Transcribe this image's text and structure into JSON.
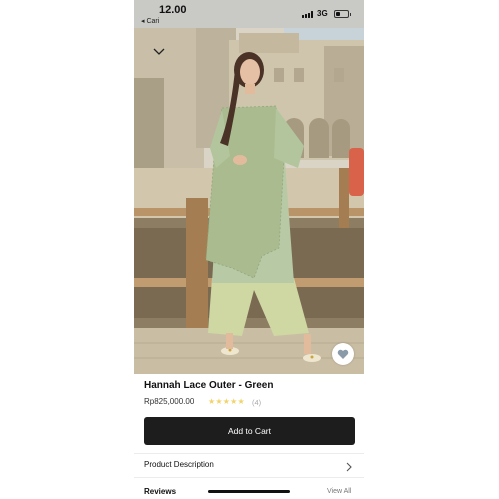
{
  "status_bar": {
    "time": "12.00",
    "back_label": "◂ Cari",
    "network": "3G"
  },
  "icons": {
    "collapse": "chevron-down-icon",
    "wishlist": "heart-icon",
    "description": "chevron-right-icon"
  },
  "product": {
    "name": "Hannah Lace Outer - Green",
    "price": "Rp825,000.00",
    "rating_stars": "★★★★★",
    "rating": 5,
    "review_count": "(4)",
    "add_to_cart_label": "Add to Cart",
    "description_label": "Product Description",
    "reviews_label": "Reviews",
    "view_all_label": "View All"
  },
  "colors": {
    "accent_button": "#1d1d1d",
    "star": "#f1d36a",
    "status_bar_bg": "#c9c9c6"
  }
}
